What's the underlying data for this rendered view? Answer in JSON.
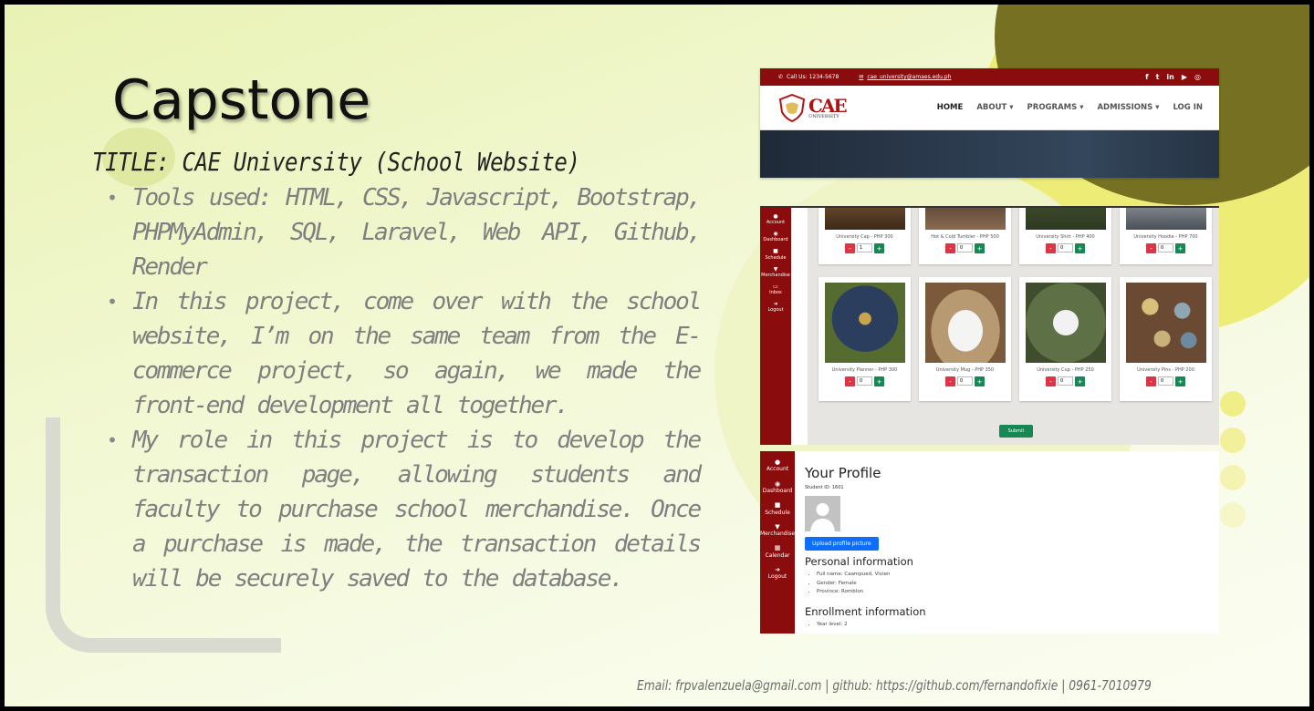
{
  "slide": {
    "title": "Capstone",
    "subtitle": "TITLE: CAE University (School Website)",
    "bullets": [
      "Tools used: HTML, CSS, Javascript, Bootstrap, PHPMyAdmin, SQL, Laravel, Web API, Github, Render",
      "In this project, come over with the school website, I’m on the same team from the E-commerce project, so again, we made the front-end development all together.",
      "My role in this project is to develop the transaction page, allowing students and faculty to purchase school merchandise. Once a purchase is made, the transaction details will be securely saved to the database."
    ],
    "footer": "Email: frpvalenzuela@gmail.com | github: https://github.com/fernandofixie | 0961-7010979"
  },
  "colors": {
    "brand_red": "#8b0c0c",
    "olive": "#767122",
    "yellow": "#ecec77",
    "minus": "#dc3545",
    "plus": "#198754",
    "upload": "#0d6efd"
  },
  "site_header": {
    "call": "Call Us: 1234-5678",
    "email": "cae_university@amaes.edu.ph",
    "social_icons": [
      "facebook-icon",
      "twitter-icon",
      "linkedin-icon",
      "youtube-icon",
      "instagram-icon"
    ],
    "logo_text": "CAE",
    "logo_sub": "UNIVERSITY",
    "nav": [
      "HOME",
      "ABOUT ▾",
      "PROGRAMS ▾",
      "ADMISSIONS ▾",
      "LOG IN"
    ]
  },
  "merch": {
    "sidebar": [
      "Account",
      "Dashboard",
      "Schedule",
      "Merchandise",
      "Inbox",
      "Logout"
    ],
    "products": [
      {
        "name": "University Cap - PHP 300",
        "qty": "1"
      },
      {
        "name": "Hot & Cold Tumbler - PHP 500",
        "qty": "0"
      },
      {
        "name": "University Shirt - PHP 400",
        "qty": "0"
      },
      {
        "name": "University Hoodie - PHP 700",
        "qty": "0"
      },
      {
        "name": "University Planner - PHP 300",
        "qty": "0"
      },
      {
        "name": "University Mug - PHP 350",
        "qty": "0"
      },
      {
        "name": "University Cup - PHP 250",
        "qty": "0"
      },
      {
        "name": "University Pins - PHP 200",
        "qty": "0"
      }
    ],
    "minus": "-",
    "plus": "+",
    "submit": "Submit"
  },
  "profile": {
    "sidebar": [
      "Account",
      "Dashboard",
      "Schedule",
      "Merchandise",
      "Calendar",
      "Logout"
    ],
    "heading": "Your Profile",
    "student_id": "Student ID: 1601",
    "upload": "Upload profile picture",
    "personal_heading": "Personal information",
    "personal": [
      "Full name: Caampued, Vivien",
      "Gender: Female",
      "Province: Romblon"
    ],
    "enroll_heading": "Enrollment information",
    "enroll": [
      "Year level: 2"
    ]
  }
}
